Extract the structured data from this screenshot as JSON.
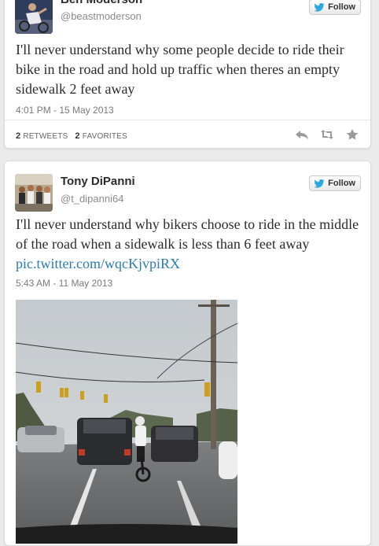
{
  "tweets": [
    {
      "name": "Ben Moderson",
      "handle": "@beastmoderson",
      "follow_label": "Follow",
      "text": "I'll never understand why some people decide to ride their bike in the road and hold up traffic when theres an empty sidewalk 2 feet away",
      "time": "4:01 PM - 15 May 2013",
      "retweets_count": "2",
      "retweets_label": "RETWEETS",
      "favorites_count": "2",
      "favorites_label": "FAVORITES",
      "icons": [
        "reply-icon",
        "retweet-icon",
        "favorite-icon"
      ]
    },
    {
      "name": "Tony DiPanni",
      "handle": "@t_dipanni64",
      "follow_label": "Follow",
      "text": "I'll never understand why bikers choose to ride in the middle of the road when a sidewalk is less than 6 feet away",
      "link": "pic.twitter.com/wqcKjvpiRX",
      "time": "5:43 AM - 11 May 2013"
    }
  ],
  "colors": {
    "link": "#2a7bb5",
    "twitter_bird": "#2aa9e0",
    "background": "#ebebeb"
  }
}
